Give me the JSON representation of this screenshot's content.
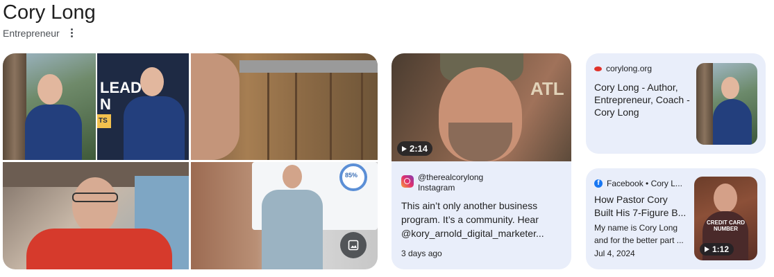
{
  "header": {
    "title": "Cory Long",
    "subtitle": "Entrepreneur",
    "more_icon": "vertical-dots-icon"
  },
  "collage": {
    "overlay_text_top": "LEAD",
    "overlay_text_bottom": "N",
    "overlay_text_small": "TS",
    "stat_badge": "85%",
    "image_icon": "image-icon"
  },
  "instagram_card": {
    "duration": "2:14",
    "handle": "@therealcorylong",
    "platform": "Instagram",
    "text": "This ain’t only another business program. It’s a community. Hear @kory_arnold_digital_marketer...",
    "date": "3 days ago",
    "logo_icon": "instagram-icon",
    "thumb_sign": "ATL"
  },
  "web_card": {
    "source": "corylong.org",
    "title": "Cory Long - Author, Entrepreneur, Coach - Cory Long",
    "favicon": "corylong-favicon"
  },
  "facebook_card": {
    "source": "Facebook • Cory L...",
    "title": "How Pastor Cory Built His 7-Figure B...",
    "snippet": "My name is Cory Long and for the better part ...",
    "date": "Jul 4, 2024",
    "duration": "1:12",
    "thumb_caption": "CREDIT CARD NUMBER",
    "logo_icon": "facebook-icon"
  },
  "colors": {
    "card_bg": "#e9eefa",
    "badge_bg": "#202124",
    "instagram_gradient_start": "#f9a13a",
    "facebook_blue": "#1877f2",
    "favicon_red": "#e0332a"
  }
}
